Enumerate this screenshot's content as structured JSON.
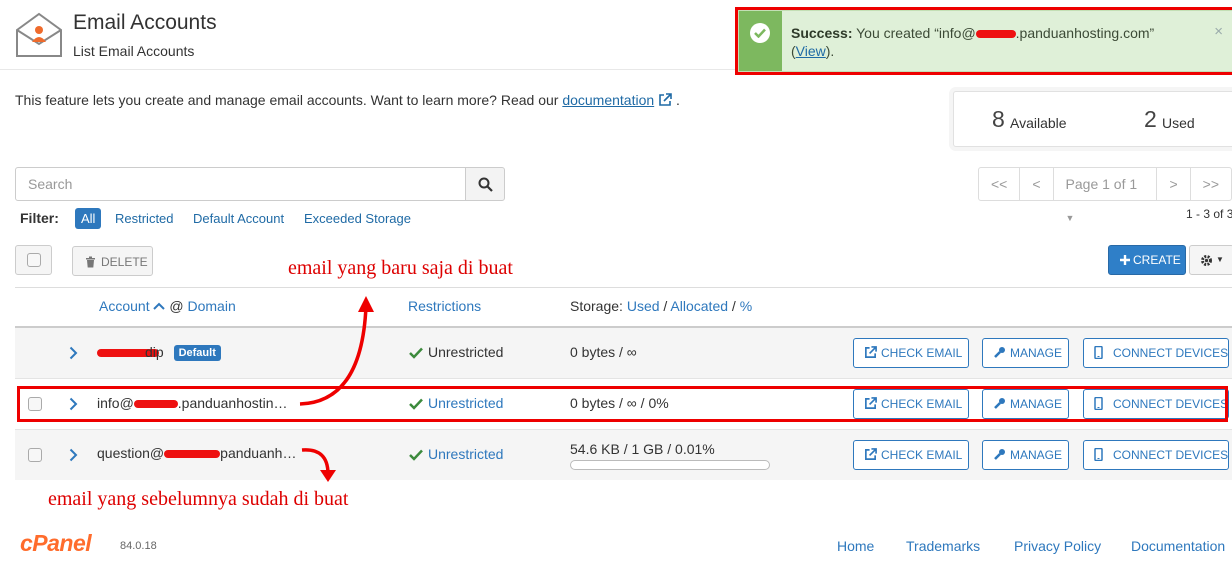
{
  "header": {
    "title": "Email Accounts",
    "subtitle": "List Email Accounts"
  },
  "alert": {
    "label": "Success:",
    "message_pre": "You created “info@",
    "message_post": ".panduanhosting.com”",
    "paren_open": "(",
    "link": "View",
    "paren_close": ").",
    "close": "×"
  },
  "intro": {
    "text": "This feature lets you create and manage email accounts. Want to learn more? Read our ",
    "link": "documentation",
    "tail": "."
  },
  "quota": {
    "available_count": "8",
    "available_label": "Available",
    "used_count": "2",
    "used_label": "Used"
  },
  "search": {
    "placeholder": "Search"
  },
  "filter": {
    "label": "Filter:",
    "options": [
      "All",
      "Restricted",
      "Default Account",
      "Exceeded Storage"
    ]
  },
  "pager": {
    "first": "<<",
    "prev": "<",
    "page": "Page 1 of 1",
    "next": ">",
    "last": ">>",
    "range": "1 - 3 of 3"
  },
  "toolbar": {
    "delete": "DELETE",
    "create": "CREATE"
  },
  "table": {
    "col_account": "Account",
    "col_at": "@",
    "col_domain": "Domain",
    "col_restrictions": "Restrictions",
    "col_storage": "Storage:",
    "col_used": "Used",
    "col_allocated": "Allocated",
    "col_percent": "%",
    "slash": "/",
    "rows": [
      {
        "account_pre": "",
        "account_post": "dip",
        "badge": "Default",
        "restriction": "Unrestricted",
        "storage": "0 bytes / ∞"
      },
      {
        "account_pre": "info@",
        "account_post": ".panduanhostin…",
        "restriction": "Unrestricted",
        "storage": "0 bytes / ∞ / 0%"
      },
      {
        "account_pre": "question@",
        "account_post": "panduanh…",
        "restriction": "Unrestricted",
        "storage": "54.6 KB / 1 GB / 0.01%",
        "usage_fraction": 0.0001
      }
    ],
    "actions": {
      "check_email": "CHECK EMAIL",
      "manage": "MANAGE",
      "connect_devices": "CONNECT DEVICES"
    }
  },
  "annotations": {
    "new_email": "email yang baru saja di buat",
    "previous_email": "email yang sebelumnya sudah di buat"
  },
  "footer": {
    "logo": "cPanel",
    "version": "84.0.18",
    "links": [
      "Home",
      "Trademarks",
      "Privacy Policy",
      "Documentation"
    ]
  },
  "colors": {
    "primary": "#2e78bd",
    "success_bg": "#dff0d8",
    "success_bar": "#7db85f",
    "annotation": "#ee1111",
    "brand": "#ff6c2c"
  }
}
